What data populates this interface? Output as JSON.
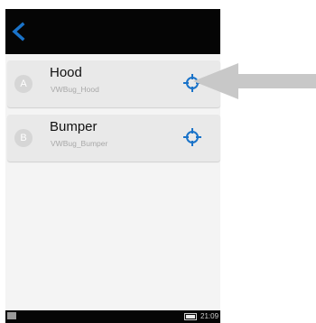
{
  "screen": {
    "items": [
      {
        "avatar_letter": "A",
        "title": "Hood",
        "subtitle": "VWBug_Hood",
        "action_icon": "crosshair-target-icon"
      },
      {
        "avatar_letter": "B",
        "title": "Bumper",
        "subtitle": "VWBug_Bumper",
        "action_icon": "crosshair-target-icon"
      }
    ],
    "back_icon": "chevron-left-icon"
  },
  "status_bar": {
    "time": "21:09"
  },
  "colors": {
    "accent": "#1a73c9",
    "top_bar": "#050505",
    "item_bg": "#e9e9e9",
    "annotation_arrow": "#c8c8c8"
  }
}
